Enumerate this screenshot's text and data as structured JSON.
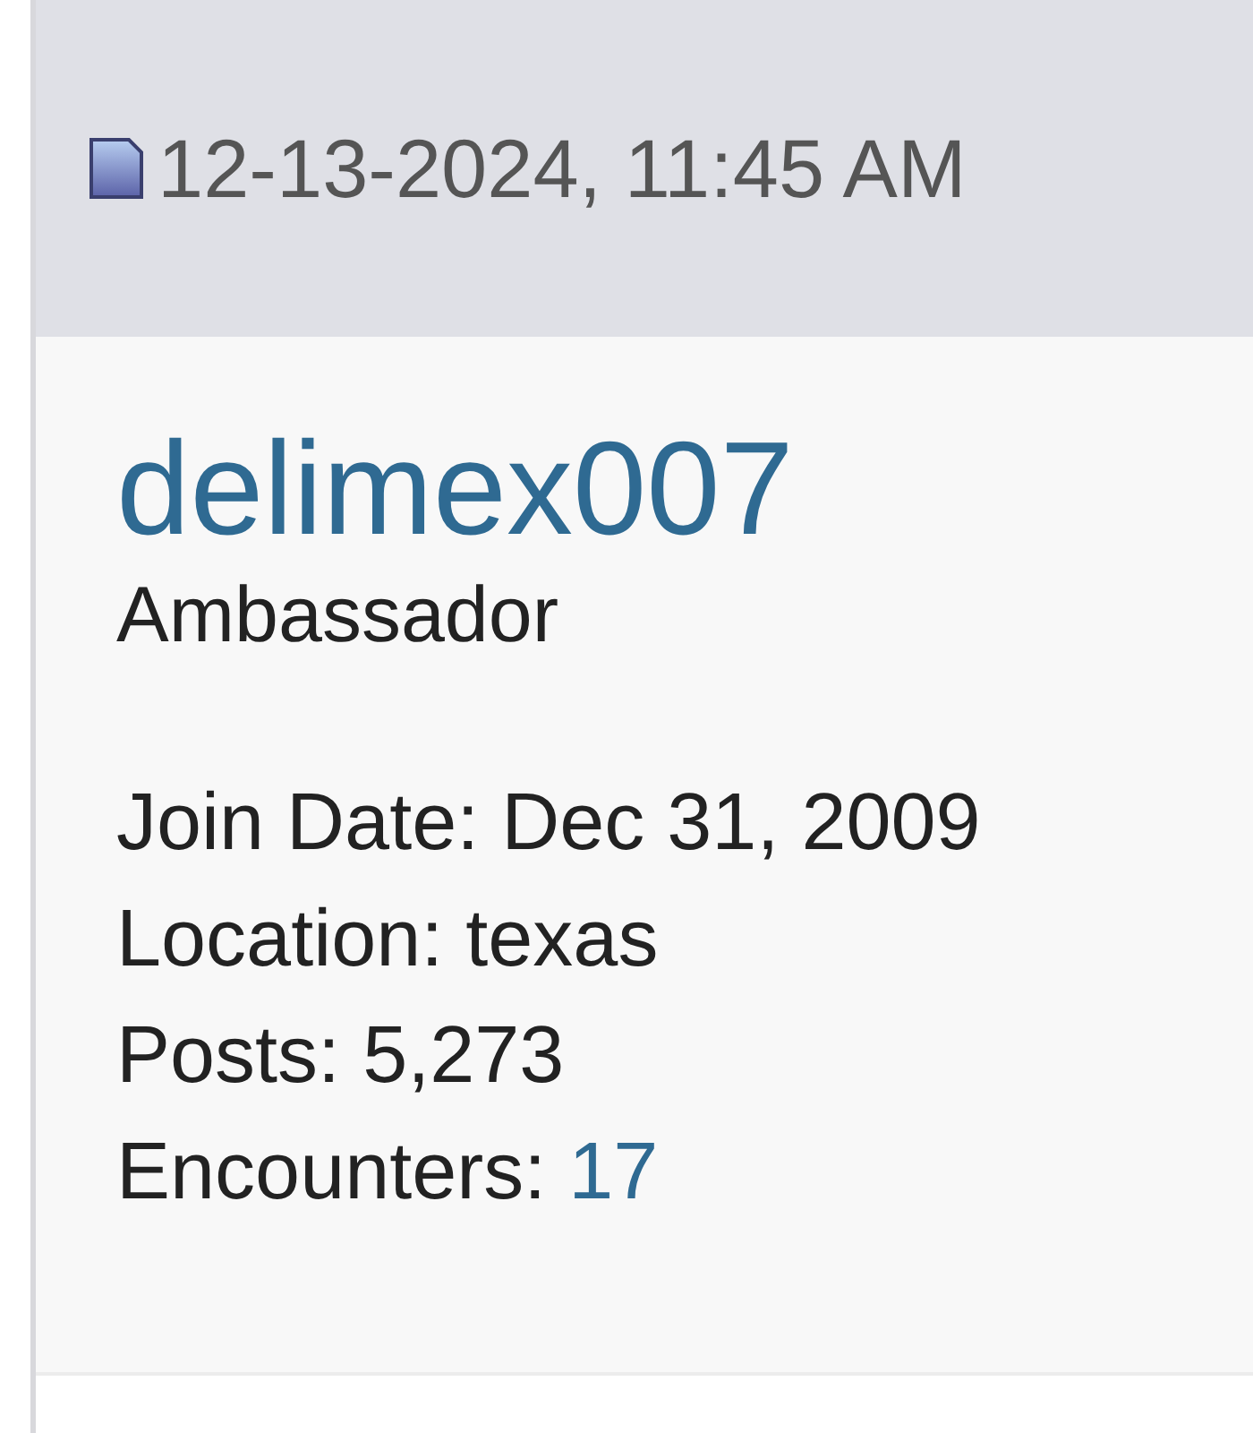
{
  "post": {
    "date": "12-13-2024, 11:45 AM"
  },
  "user": {
    "name": "delimex007",
    "title": "Ambassador",
    "stats": [
      {
        "kind": "text",
        "label": "Join Date:",
        "value": "Dec 31, 2009"
      },
      {
        "kind": "text",
        "label": "Location:",
        "value": "texas"
      },
      {
        "kind": "text",
        "label": "Posts:",
        "value": "5,273"
      },
      {
        "kind": "link",
        "label": "Encounters:",
        "value": "17"
      }
    ]
  }
}
